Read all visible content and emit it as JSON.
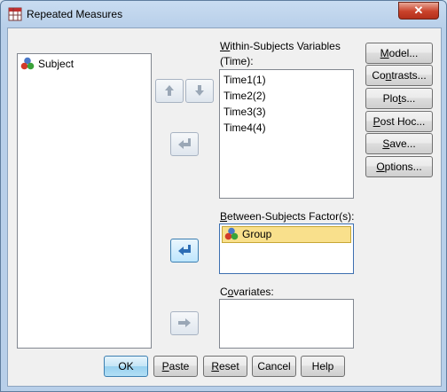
{
  "window": {
    "title": "Repeated Measures",
    "close_glyph": "✕"
  },
  "source_list": {
    "items": [
      {
        "label": "Subject",
        "icon": "scale-variable-icon"
      }
    ]
  },
  "within": {
    "label_underline": "W",
    "label_rest": "ithin-Subjects Variables",
    "factor_label": "(Time):",
    "items": [
      "Time1(1)",
      "Time2(2)",
      "Time3(3)",
      "Time4(4)"
    ]
  },
  "between": {
    "label_underline": "B",
    "label_rest": "etween-Subjects Factor(s):",
    "items": [
      {
        "label": "Group",
        "icon": "nominal-variable-icon",
        "selected": true
      }
    ]
  },
  "covariates": {
    "label_pre": "C",
    "label_underline": "o",
    "label_rest": "variates:"
  },
  "side_buttons": [
    {
      "pre": "",
      "u": "M",
      "post": "odel..."
    },
    {
      "pre": "Co",
      "u": "n",
      "post": "trasts..."
    },
    {
      "pre": "Plo",
      "u": "t",
      "post": "s..."
    },
    {
      "pre": "",
      "u": "P",
      "post": "ost Hoc..."
    },
    {
      "pre": "",
      "u": "S",
      "post": "ave..."
    },
    {
      "pre": "",
      "u": "O",
      "post": "ptions..."
    }
  ],
  "bottom_buttons": [
    {
      "pre": "",
      "u": "",
      "post": "OK"
    },
    {
      "pre": "",
      "u": "P",
      "post": "aste"
    },
    {
      "pre": "",
      "u": "R",
      "post": "eset"
    },
    {
      "pre": "Cancel",
      "u": "",
      "post": ""
    },
    {
      "pre": "Help",
      "u": "",
      "post": ""
    }
  ],
  "colors": {
    "selection": "#f9e08c",
    "accent": "#3c7fb1",
    "close": "#c9412a"
  }
}
